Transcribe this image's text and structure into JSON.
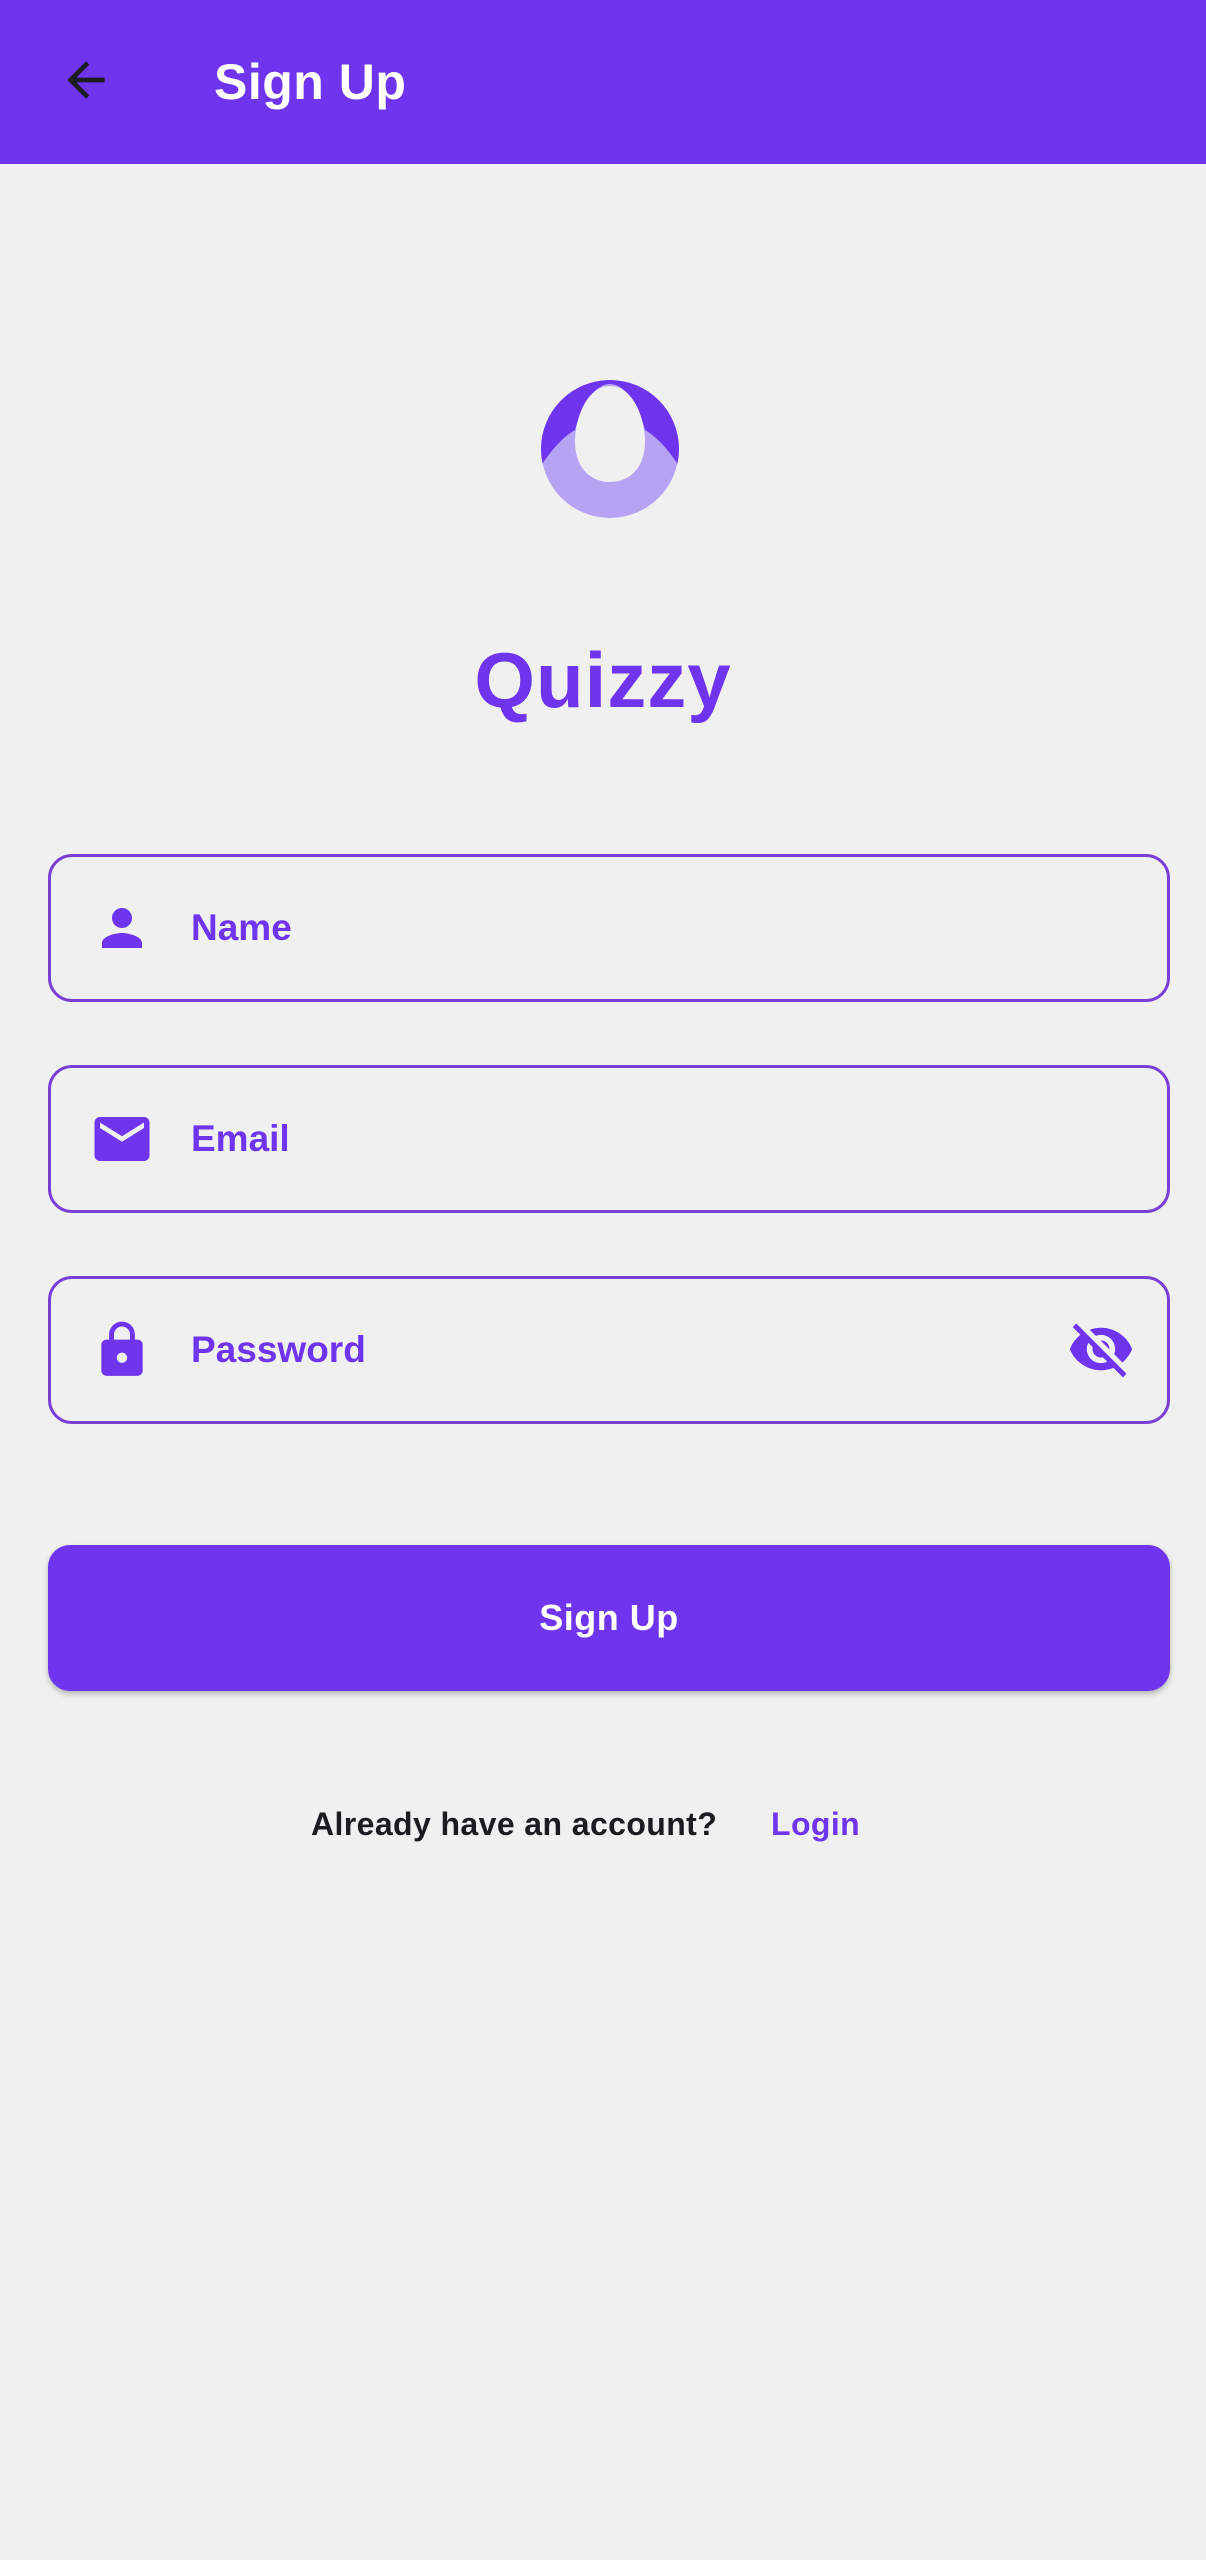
{
  "appbar": {
    "title": "Sign Up",
    "back_icon": "arrow-left-icon",
    "background": "#6f34ee"
  },
  "brand": {
    "name": "Quizzy",
    "logo_icon": "quizzy-logo",
    "color": "#6f34ee"
  },
  "form": {
    "name": {
      "placeholder": "Name",
      "value": "",
      "icon": "person-icon"
    },
    "email": {
      "placeholder": "Email",
      "value": "",
      "icon": "envelope-icon"
    },
    "password": {
      "placeholder": "Password",
      "value": "",
      "icon": "lock-icon",
      "toggle_icon": "eye-off-icon"
    },
    "submit_label": "Sign Up"
  },
  "footer": {
    "question": "Already have an account?",
    "login_label": "Login"
  }
}
